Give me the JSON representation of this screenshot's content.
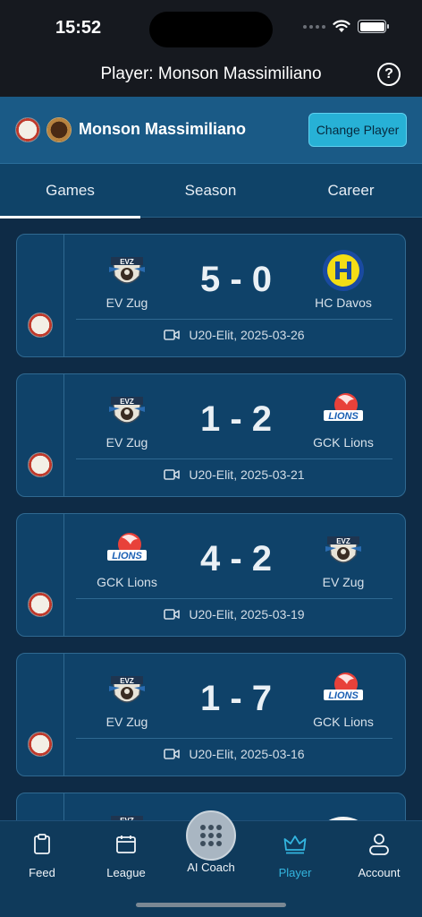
{
  "status": {
    "time": "15:52"
  },
  "header": {
    "title": "Player: Monson Massimiliano",
    "help_label": "?"
  },
  "player_bar": {
    "name": "Monson Massimiliano",
    "change_label": "Change Player"
  },
  "tabs": [
    {
      "label": "Games",
      "active": true
    },
    {
      "label": "Season",
      "active": false
    },
    {
      "label": "Career",
      "active": false
    }
  ],
  "games": [
    {
      "home": "EV Zug",
      "home_logo": "evz-logo",
      "score": "5 - 0",
      "away": "HC Davos",
      "away_logo": "hc-davos-logo",
      "info": "U20-Elit, 2025-03-26"
    },
    {
      "home": "EV Zug",
      "home_logo": "evz-logo",
      "score": "1 - 2",
      "away": "GCK Lions",
      "away_logo": "gck-lions-logo",
      "info": "U20-Elit, 2025-03-21"
    },
    {
      "home": "GCK Lions",
      "home_logo": "gck-lions-logo",
      "score": "4 - 2",
      "away": "EV Zug",
      "away_logo": "evz-logo",
      "info": "U20-Elit, 2025-03-19"
    },
    {
      "home": "EV Zug",
      "home_logo": "evz-logo",
      "score": "1 - 7",
      "away": "GCK Lions",
      "away_logo": "gck-lions-logo",
      "info": "U20-Elit, 2025-03-16"
    }
  ],
  "tab_bar": [
    {
      "label": "Feed",
      "icon": "clipboard-icon"
    },
    {
      "label": "League",
      "icon": "calendar-icon"
    },
    {
      "label": "AI Coach",
      "icon": "grid-dots-icon"
    },
    {
      "label": "Player",
      "icon": "crown-icon",
      "active": true
    },
    {
      "label": "Account",
      "icon": "person-icon"
    }
  ],
  "colors": {
    "accent": "#33b5df",
    "button": "#27b1d6",
    "card": "#0f4269"
  }
}
